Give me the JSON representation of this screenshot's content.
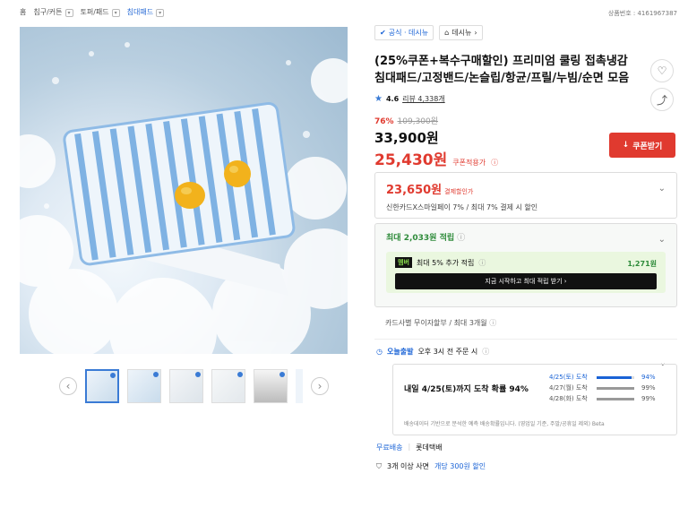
{
  "breadcrumb": {
    "items": [
      "홈",
      "침구/커튼",
      "토퍼/패드",
      "침대패드"
    ]
  },
  "product_number": "상품번호 : 4161967387",
  "gallery": {
    "prev_icon": "chevron-left-icon",
    "next_icon": "chevron-right-icon",
    "thumb_count": 6
  },
  "brand": {
    "official_label": "공식 · 데시뉴",
    "store_label": "데시뉴"
  },
  "product": {
    "title": "(25%쿠폰+복수구매할인) 프리미엄 쿨링 접촉냉감 침대패드/고정밴드/논슬립/항균/프릴/누빔/순면 모음",
    "rating": "4.6",
    "review_label": "리뷰 4,338개"
  },
  "price": {
    "discount": "76%",
    "original": "109,300원",
    "sale": "33,900원",
    "coupon_price": "25,430원",
    "coupon_price_label": "쿠폰적용가",
    "coupon_button": "쿠폰받기"
  },
  "card_discount": {
    "price": "23,650원",
    "label": "결제할인가",
    "detail": "신한카드X스마일페이 7% / 최대 7% 결제 시 할인"
  },
  "points": {
    "max_prefix": "최대",
    "max_value": "2,033원",
    "max_suffix": "적립",
    "member_badge": "멤버",
    "member_text": "최대 5% 추가 적립",
    "member_points": "1,271원",
    "member_cta": "지금 시작하고 최대 적립 받기"
  },
  "installment": "카드사별 무이자할부 / 최대 3개월",
  "shipping": {
    "logo": "오늘출발",
    "text": "오후 3시 전 주문 시",
    "arrival": "내일 4/25(토)까지 도착 확률 94%",
    "rows": [
      {
        "date": "4/25(토) 도착",
        "pct": "94%",
        "value": 0.94,
        "highlight": true
      },
      {
        "date": "4/27(월) 도착",
        "pct": "99%",
        "value": 0.99,
        "highlight": false
      },
      {
        "date": "4/28(화) 도착",
        "pct": "99%",
        "value": 0.99,
        "highlight": false
      }
    ],
    "note": "배송데이터 기반으로 분석한 예측 배송확률입니다. (영업일 기준, 주말/공휴일 제외)  Beta",
    "free": "무료배송",
    "carrier": "롯데택배"
  },
  "bundle": {
    "prefix": "3개 이상 사면",
    "accent": "개당 300원 할인"
  },
  "colors": {
    "accent": "#1a63d6",
    "sale": "#e03a2f",
    "green": "#2e8b3a"
  }
}
